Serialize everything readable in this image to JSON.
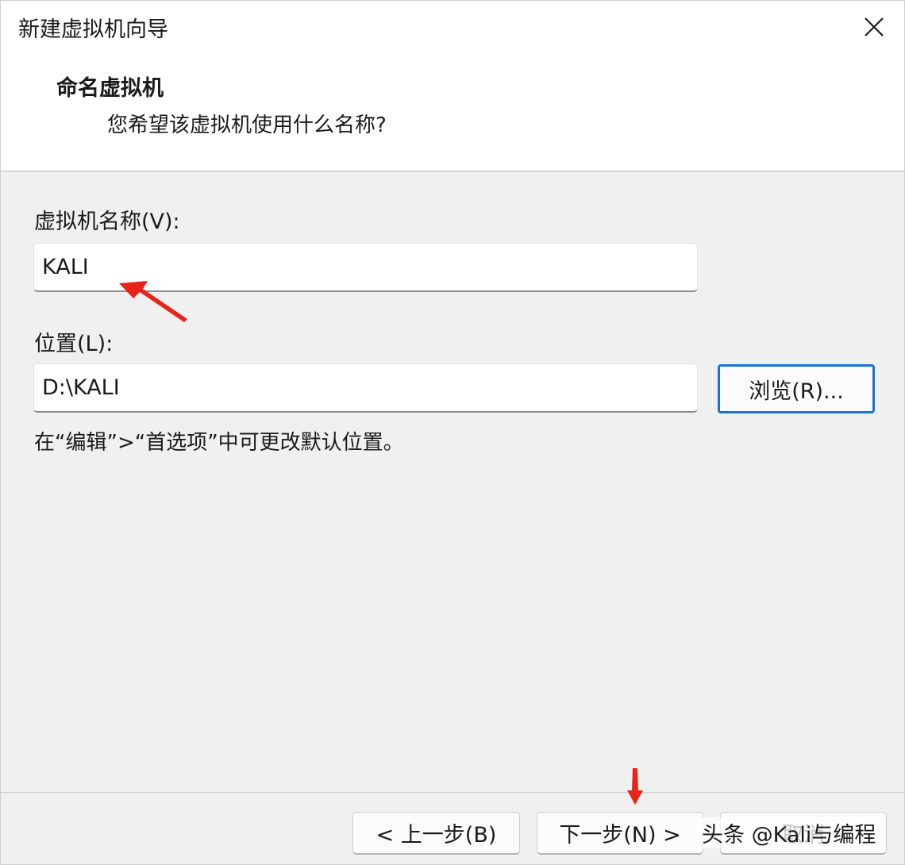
{
  "window": {
    "title": "新建虚拟机向导"
  },
  "header": {
    "title": "命名虚拟机",
    "subtitle": "您希望该虚拟机使用什么名称?"
  },
  "form": {
    "name_label": "虚拟机名称(V):",
    "name_value": "KALI",
    "location_label": "位置(L):",
    "location_value": "D:\\KALI",
    "browse_label": "浏览(R)...",
    "hint": "在“编辑”>“首选项”中可更改默认位置。"
  },
  "footer": {
    "back_label": "< 上一步(B)",
    "next_label": "下一步(N) >",
    "third_label": "取消"
  },
  "overlay": {
    "watermark": "头条 @Kali与编程"
  },
  "colors": {
    "annotation_arrow": "#e8241a",
    "accent_border": "#1874d0"
  },
  "icons": {
    "close": "close-icon"
  }
}
